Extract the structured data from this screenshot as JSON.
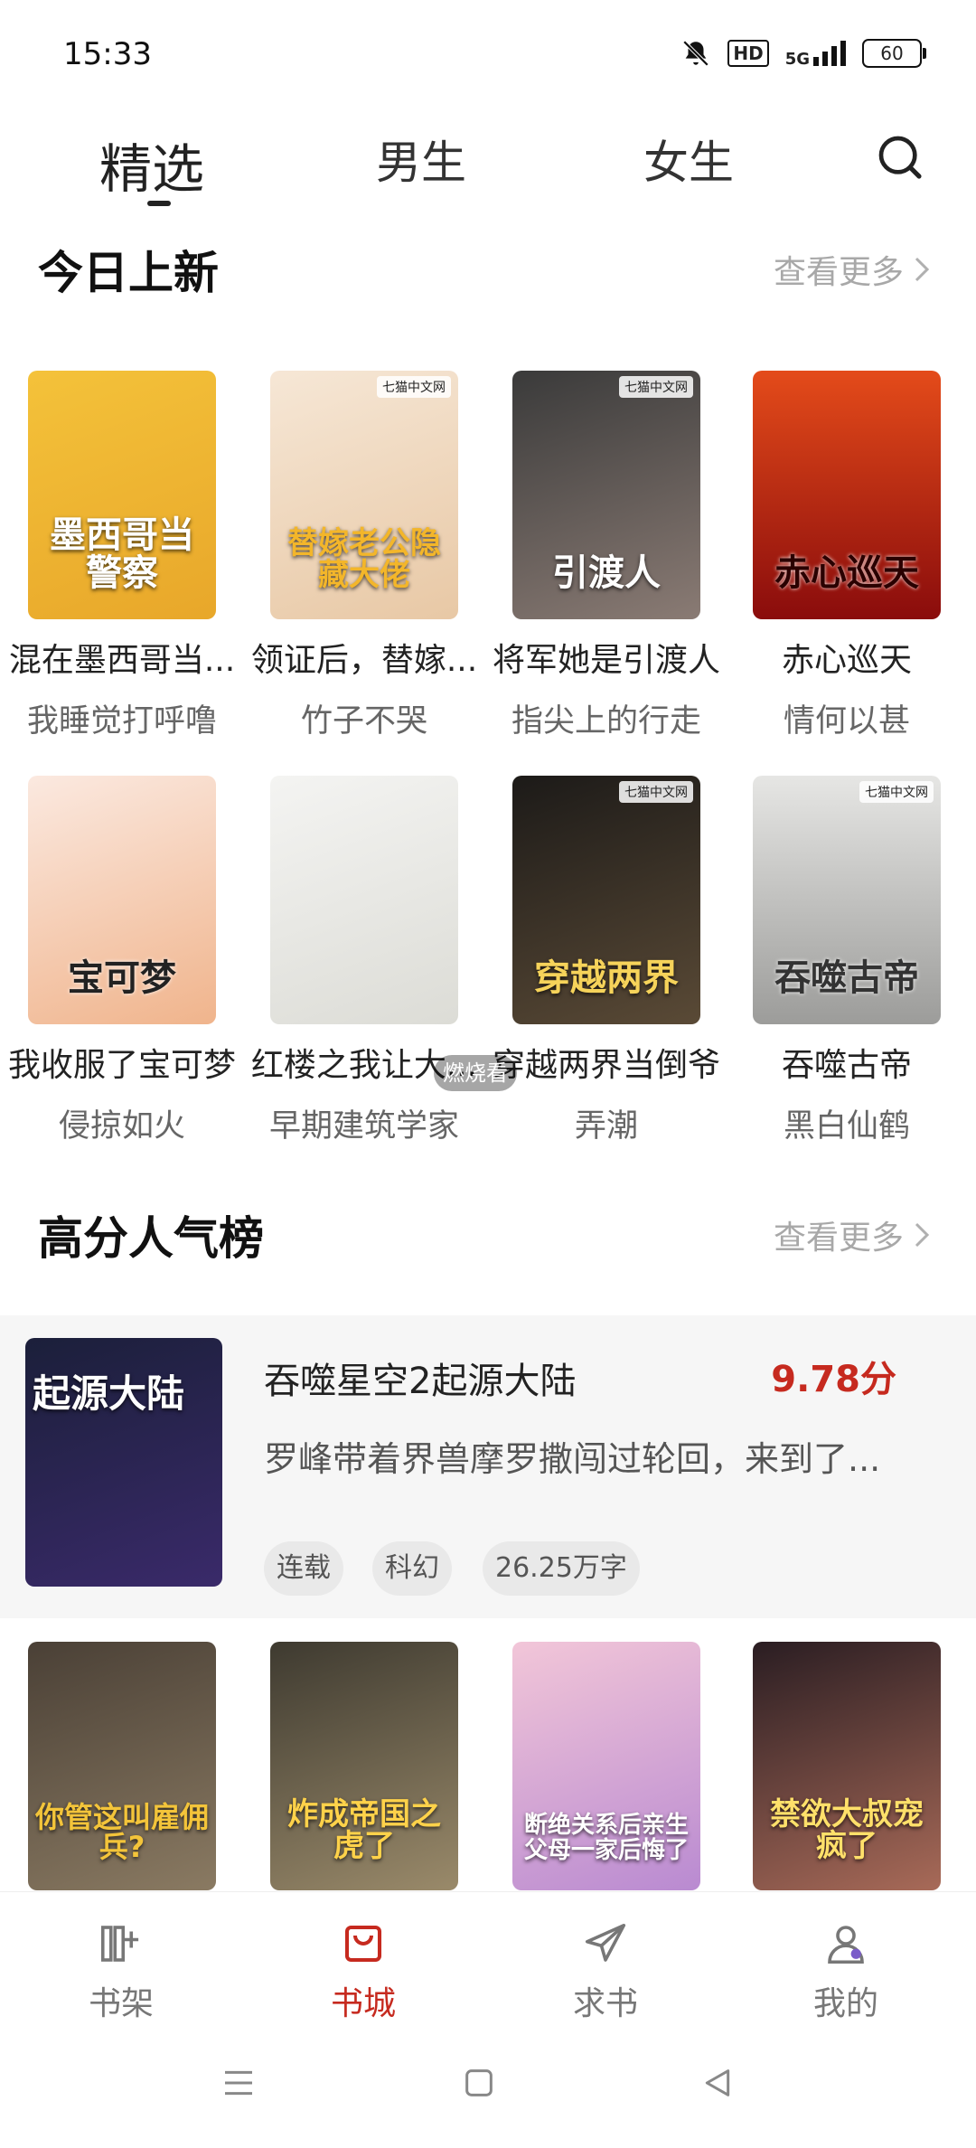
{
  "status_bar": {
    "time": "15:33",
    "hd": "HD",
    "network": "5G",
    "battery": "60"
  },
  "top_tabs": [
    {
      "label": "精选",
      "active": true
    },
    {
      "label": "男生",
      "active": false
    },
    {
      "label": "女生",
      "active": false
    }
  ],
  "sections": {
    "new_today": {
      "title": "今日上新",
      "more": "查看更多"
    },
    "popular": {
      "title": "高分人气榜",
      "more": "查看更多"
    }
  },
  "new_books": [
    {
      "title": "混在墨西哥当...",
      "author": "我睡觉打呼噜",
      "cover_text": "墨西哥当警察",
      "cover_badge": "",
      "colors": [
        "#f4c23a",
        "#e8a72a"
      ]
    },
    {
      "title": "领证后，替嫁...",
      "author": "竹子不哭",
      "cover_text": "替嫁老公隐藏大佬",
      "cover_badge": "七猫中文网",
      "colors": [
        "#f6e7d6",
        "#e8c8a5"
      ]
    },
    {
      "title": "将军她是引渡人",
      "author": "指尖上的行走",
      "cover_text": "引渡人",
      "cover_badge": "七猫中文网",
      "colors": [
        "#3a3a3a",
        "#8a7b74"
      ]
    },
    {
      "title": "赤心巡天",
      "author": "情何以甚",
      "cover_text": "赤心巡天",
      "cover_badge": "",
      "colors": [
        "#e44b1a",
        "#8a0c0c"
      ]
    },
    {
      "title": "我收服了宝可梦",
      "author": "侵掠如火",
      "cover_text": "宝可梦",
      "cover_badge": "",
      "colors": [
        "#fbe9e0",
        "#f0b48c"
      ]
    },
    {
      "title": "红楼之我让大...",
      "author": "早期建筑学家",
      "cover_text": "",
      "cover_badge": "",
      "colors": [
        "#f4f4f2",
        "#dcdcd6"
      ]
    },
    {
      "title": "穿越两界当倒爷",
      "author": "弄潮",
      "cover_text": "穿越两界",
      "cover_badge": "七猫中文网",
      "colors": [
        "#1c1a18",
        "#5a4a36"
      ]
    },
    {
      "title": "吞噬古帝",
      "author": "黑白仙鹤",
      "cover_text": "吞噬古帝",
      "cover_badge": "七猫中文网",
      "colors": [
        "#e6e6e4",
        "#9c9c9a"
      ]
    }
  ],
  "featured": {
    "title": "吞噬星空2起源大陆",
    "score": "9.78分",
    "description": "罗峰带着界兽摩罗撒闯过轮回，来到了...",
    "tags": [
      "连载",
      "科幻",
      "26.25万字"
    ],
    "cover_text": "起源大陆",
    "colors": [
      "#1b1f3a",
      "#3a2a6a"
    ]
  },
  "popular_books": [
    {
      "cover_text": "你管这叫雇佣兵?",
      "colors": [
        "#4a4036",
        "#8a7a62"
      ]
    },
    {
      "cover_text": "炸成帝国之虎了",
      "colors": [
        "#3e3a30",
        "#9a8a6a"
      ]
    },
    {
      "cover_text": "断绝关系后亲生父母一家后悔了",
      "colors": [
        "#f2c6d8",
        "#b98ad1"
      ]
    },
    {
      "cover_text": "禁欲大叔宠疯了",
      "colors": [
        "#2a1d22",
        "#a86a58"
      ]
    }
  ],
  "bottom_nav": [
    {
      "label": "书架",
      "active": false
    },
    {
      "label": "书城",
      "active": true
    },
    {
      "label": "求书",
      "active": false
    },
    {
      "label": "我的",
      "active": false
    }
  ],
  "watermark": "燃烧看",
  "accent_color": "#c62a1f"
}
